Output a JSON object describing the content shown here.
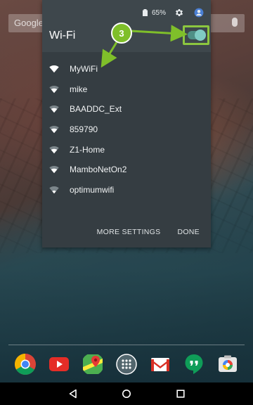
{
  "background": {
    "search_logo": "Google"
  },
  "wifi_panel": {
    "status": {
      "battery_percent": "65%",
      "icons": [
        "battery-icon",
        "gear-icon",
        "account-icon"
      ]
    },
    "title": "Wi-Fi",
    "toggle_on": true,
    "networks": [
      {
        "ssid": "MyWiFi",
        "signal": "full"
      },
      {
        "ssid": "mike",
        "signal": "medium"
      },
      {
        "ssid": "BAADDC_Ext",
        "signal": "medium"
      },
      {
        "ssid": "859790",
        "signal": "medium"
      },
      {
        "ssid": "Z1-Home",
        "signal": "medium"
      },
      {
        "ssid": "MamboNetOn2",
        "signal": "medium"
      },
      {
        "ssid": "optimumwifi",
        "signal": "weak"
      }
    ],
    "actions": {
      "more_settings": "MORE SETTINGS",
      "done": "DONE"
    },
    "colors": {
      "panel": "#353d42",
      "header": "#3e474c",
      "toggle": "#80cbc4",
      "highlight": "#8cc63f"
    }
  },
  "annotation": {
    "step": "3",
    "color": "#7fbf2a"
  },
  "dock": {
    "apps": [
      "chrome-icon",
      "youtube-icon",
      "maps-icon",
      "app-drawer-icon",
      "gmail-icon",
      "hangouts-icon",
      "photos-icon"
    ]
  },
  "navbar": {
    "buttons": [
      "back-icon",
      "home-icon",
      "recents-icon"
    ]
  }
}
